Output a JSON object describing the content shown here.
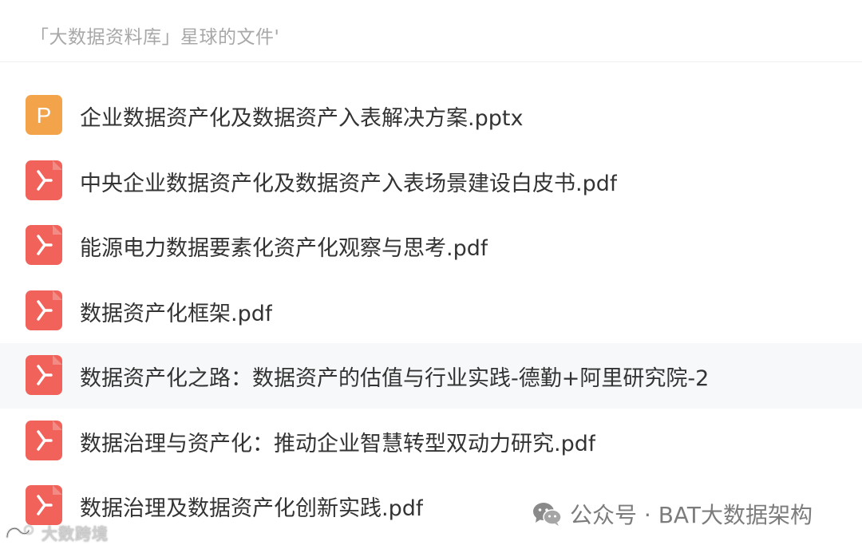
{
  "header": {
    "title": "「大数据资料库」星球的文件'"
  },
  "files": [
    {
      "name": "企业数据资产化及数据资产入表解决方案.pptx",
      "type": "pptx",
      "icon": "pptx-file-icon"
    },
    {
      "name": "中央企业数据资产化及数据资产入表场景建设白皮书.pdf",
      "type": "pdf",
      "icon": "pdf-file-icon"
    },
    {
      "name": "能源电力数据要素化资产化观察与思考.pdf",
      "type": "pdf",
      "icon": "pdf-file-icon"
    },
    {
      "name": "数据资产化框架.pdf",
      "type": "pdf",
      "icon": "pdf-file-icon"
    },
    {
      "name": "数据资产化之路：数据资产的估值与行业实践-德勤+阿里研究院-2…",
      "type": "pdf",
      "icon": "pdf-file-icon"
    },
    {
      "name": "数据治理与资产化：推动企业智慧转型双动力研究.pdf",
      "type": "pdf",
      "icon": "pdf-file-icon"
    },
    {
      "name": "数据治理及数据资产化创新实践.pdf",
      "type": "pdf",
      "icon": "pdf-file-icon"
    }
  ],
  "watermark": {
    "text": "公众号 · BAT大数据架构",
    "icon": "wechat-icon"
  },
  "corner_mark": {
    "text": "大数跨境",
    "icon": "brand-logo-icon"
  },
  "colors": {
    "pptx_icon": "#f3a44a",
    "pdf_icon": "#f0625a",
    "hover_row": "#f7f8fa",
    "header_text": "#a8a8a8",
    "file_text": "#333333"
  }
}
